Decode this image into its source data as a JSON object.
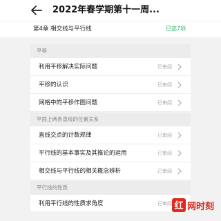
{
  "header": {
    "title": "2022年春学期第十一周...",
    "back_icon": "arrow-left-icon"
  },
  "chapter": {
    "title": "第4章 相交线与平行线",
    "selected": "已选7项"
  },
  "sections": [
    {
      "title": "平移",
      "items": [
        {
          "label": "利用平移解决实际问题",
          "status": "已审阅"
        },
        {
          "label": "平移的认识",
          "status": "已审阅"
        },
        {
          "label": "网格中的平移作图问题",
          "status": "已审阅"
        }
      ]
    },
    {
      "title": "平面上两条直线的位置关系",
      "items": [
        {
          "label": "直线交点的计数规律",
          "status": "已审阅"
        },
        {
          "label": "平行线的基本事实及其推论的运用",
          "status": "已审阅"
        },
        {
          "label": "相交线与平行线的相关概念辨析",
          "status": "已审阅"
        }
      ]
    },
    {
      "title": "平行线的性质",
      "items": [
        {
          "label": "利用平行线的性质求角度",
          "status": "已审阅"
        }
      ]
    }
  ],
  "watermark": {
    "text": "红网时刻",
    "color": "#e02a20"
  },
  "colors": {
    "accent": "#2aaf6a",
    "section_bg": "#ececec"
  }
}
